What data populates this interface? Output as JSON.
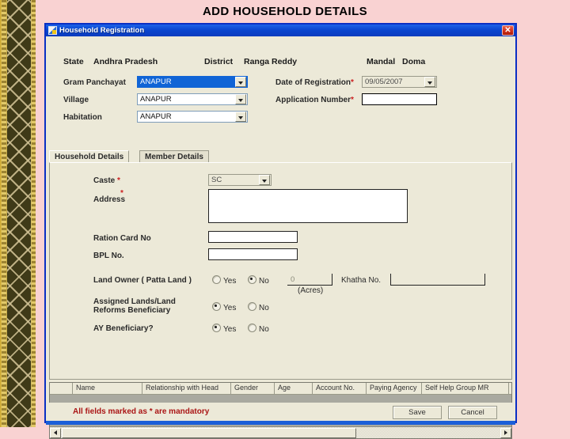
{
  "page_title": "ADD HOUSEHOLD DETAILS",
  "window": {
    "title": "Household Registration",
    "icon": "window-app-icon",
    "close_label": "✕"
  },
  "header": {
    "state_label": "State",
    "state_value": "Andhra Pradesh",
    "district_label": "District",
    "district_value": "Ranga Reddy",
    "mandal_label": "Mandal",
    "mandal_value": "Doma"
  },
  "location_fields": {
    "gram_panchayat_label": "Gram Panchayat",
    "gram_panchayat_value": "ANAPUR",
    "village_label": "Village",
    "village_value": "ANAPUR",
    "habitation_label": "Habitation",
    "habitation_value": "ANAPUR"
  },
  "registration_fields": {
    "date_label": "Date of Registration",
    "date_required": "*",
    "date_value": "09/05/2007",
    "application_label": "Application Number",
    "application_required": "*",
    "application_value": "",
    "application_placeholder": ""
  },
  "tabs": [
    {
      "label": "Household Details",
      "active": true
    },
    {
      "label": "Member Details",
      "active": false
    }
  ],
  "household_form": {
    "caste_label": "Caste",
    "caste_required": "*",
    "caste_value": "SC",
    "address_label": "Address",
    "address_required": "*",
    "address_value": "",
    "ration_card_label": "Ration Card No",
    "ration_card_value": "",
    "bpl_label": "BPL No.",
    "bpl_value": "",
    "land_owner_label": "Land Owner ( Patta Land )",
    "land_owner_yes": "Yes",
    "land_owner_no": "No",
    "land_owner_selected": "No",
    "acres_value": "0",
    "acres_label": "(Acres)",
    "khatha_label": "Khatha No.",
    "khatha_value": "",
    "assigned_land_label_line1": "Assigned Lands/Land",
    "assigned_land_label_line2": "Reforms Beneficiary",
    "assigned_land_yes": "Yes",
    "assigned_land_no": "No",
    "assigned_land_selected": "Yes",
    "ay_label": "AY Beneficiary?",
    "ay_yes": "Yes",
    "ay_no": "No",
    "ay_selected": "Yes"
  },
  "member_grid": {
    "columns": [
      "Name",
      "Relationship with Head",
      "Gender",
      "Age",
      "Account No.",
      "Paying Agency",
      "Self Help Group MR"
    ],
    "rows": []
  },
  "footer": {
    "mandatory_note": "All fields marked as * are mandatory",
    "save_label": "Save",
    "cancel_label": "Cancel"
  },
  "colors": {
    "page_background": "#f9d2d2",
    "window_chrome": "#ece9d8",
    "titlebar": "#0a46d0",
    "accent_selected": "#1064d6",
    "required_red": "#cc2020",
    "note_red": "#aa1515",
    "close_button": "#cf2b17"
  }
}
